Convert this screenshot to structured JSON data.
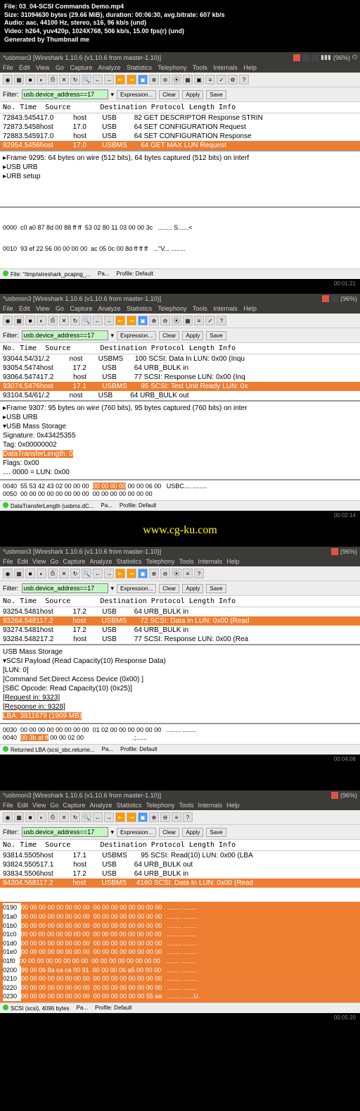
{
  "meta": {
    "file": "File: 03_04-SCSI Commands Demo.mp4",
    "size": "Size: 31094630 bytes (29.66 MiB), duration: 00:06:30, avg.bitrate: 607 kb/s",
    "audio": "Audio: aac, 44100 Hz, stereo, s16, 96 kb/s (und)",
    "video": "Video: h264, yuv420p, 1024X768, 506 kb/s, 15.00 fps(r) (und)",
    "gen": "Generated by Thumbnail me"
  },
  "menus": [
    "File",
    "Edit",
    "View",
    "Go",
    "Capture",
    "Analyze",
    "Statistics",
    "Telephony",
    "Tools",
    "Internals",
    "Help"
  ],
  "title_prefix": "*usbmon3   [Wireshark 1.10.6  (v1.10.6 from master-1.10)]",
  "tray": {
    "pct": "(96%)",
    "time_icon": "⏻"
  },
  "filter": {
    "label": "Filter:",
    "value": "usb.device_address==17",
    "exp": "Expression...",
    "clr": "Clear",
    "apl": "Apply",
    "sav": "Save"
  },
  "hdr": "No. Time  Source       Destination Protocol Length Info",
  "p1": {
    "rows": [
      {
        "t": "72843.545417.0          host        USB         82 GET DESCRIPTOR Response STRIN"
      },
      {
        "t": "72873.5458host          17.0        USB         64 SET CONFIGURATION Request"
      },
      {
        "t": "72883.545917.0          host        USB         64 SET CONFIGURATION Response"
      },
      {
        "t": "92954.5456host          17.0        USBMS       64 GET MAX LUN Request",
        "sel": true
      }
    ],
    "detail": [
      "▸Frame 9295: 64 bytes on wire (512 bits), 64 bytes captured (512 bits) on interf",
      "▸USB URB",
      "▸URB setup"
    ],
    "hex": [
      "0000  c0 a0 87 8d 00 88 ff ff  53 02 80 11 03 00 00 3c   ........ S......<",
      "0010  93 ef 22 56 00 00 00 00  ac 05 0c 00 8d ff ff ff   ...\"V... ........"
    ],
    "status": {
      "f": "File: \"/tmp/wireshark_pcapng_...",
      "p": "Pa...",
      "pr": "Profile: Default"
    },
    "ts": "00:01:21"
  },
  "p2": {
    "rows": [
      {
        "t": "93044.54/31/.2          nost        USBMS      100 SCSI: Data In LUN: 0x00 (Inqu"
      },
      {
        "t": "93054.5474host          17.2        USB         64 URB_BULK in"
      },
      {
        "t": "93064.547417.2          host        USB         77 SCSI: Response LUN: 0x00 (Inq"
      },
      {
        "t": "93074.5476host          17.1        USBMS       95 SCSI: Test Unit Ready LUN: 0x",
        "sel": true
      },
      {
        "t": "93104.54/61/.2          nost        USB         64 URB_BULK out"
      }
    ],
    "detail": [
      {
        "t": "▸Frame 9307: 95 bytes on wire (760 bits), 95 bytes captured (760 bits) on inter"
      },
      {
        "t": "▸USB URB"
      },
      {
        "t": "▾USB Mass Storage"
      },
      {
        "t": "   Signature: 0x43425355"
      },
      {
        "t": "   Tag: 0x00000002"
      },
      {
        "t": "   DataTransferLength: 0",
        "hl": true
      },
      {
        "t": "   Flags: 0x00"
      },
      {
        "t": "   .... 0000 = LUN: 0x00"
      }
    ],
    "hex": [
      "0040  55 53 42 43 02 00 00 00  ",
      "00 00 00 00",
      " 00 00 06 00   USBC.... ........",
      "0050  00 00 00 00 00 00 00 00  00 00 00 00 00 00 00"
    ],
    "status": {
      "f": "DataTransferLength (usbms.dC...",
      "p": "Pa...",
      "pr": "Profile: Default"
    },
    "ts": "00:02:14"
  },
  "wm": "www.cg-ku.com",
  "p3": {
    "rows": [
      {
        "t": "93254.5481host          17.2        USB         64 URB_BULK in"
      },
      {
        "t": "93264.548117.2          host        USBMS       72 SCSI: Data In LUN: 0x00 (Read",
        "sel": true
      },
      {
        "t": "93274.5481host          17.2        USB         64 URB_BULK in"
      },
      {
        "t": "93284.548217.2          host        USB         77 SCSI: Response LUN: 0x00 (Rea"
      }
    ],
    "detail": [
      {
        "t": " USB Mass Storage"
      },
      {
        "t": "▾SCSI Payload (Read Capacity(10) Response Data)"
      },
      {
        "t": "  [LUN: 0]"
      },
      {
        "t": "  [Command Set:Direct Access Device (0x00) ]"
      },
      {
        "t": "  [SBC Opcode: Read Capacity(10) (0x25)]"
      },
      {
        "t": "  [Request in: 9323]",
        "u": true
      },
      {
        "t": "  [Response in: 9328]",
        "u": true
      },
      {
        "t": "  LBA: 3911679 (1909 MB)",
        "hl": true
      }
    ],
    "hex": [
      "0030  00 00 00 00 00 00 00 00  01 02 00 00 00 00 00 00   ........ ........",
      "0040  ",
      "00 3b af ff",
      " 00 00 02 00                            .;......"
    ],
    "status": {
      "f": "Returned LBA (scsi_sbc.returne...",
      "p": "Pa...",
      "pr": "Profile: Default"
    },
    "ts": "00:04:08"
  },
  "p4": {
    "rows": [
      {
        "t": "93814.5505host          17.1        USBMS       95 SCSI: Read(10) LUN: 0x00 (LBA"
      },
      {
        "t": "93824.550517.1          host        USB         64 URB_BULK out"
      },
      {
        "t": "93834.5506host          17.2        USB         64 URB_BULK in"
      },
      {
        "t": "94204.568117.2          host        USBMS     4160 SCSI: Data In LUN: 0x00 (Read",
        "sel": true
      }
    ],
    "hexrows": [
      {
        "o": "0190",
        "h": "00 00 00 00 00 00 00 00  00 00 00 00 00 00 00 00",
        "a": "........ ........"
      },
      {
        "o": "01a0",
        "h": "00 00 00 00 00 00 00 00  00 00 00 00 00 00 00 00",
        "a": "........ ........"
      },
      {
        "o": "01b0",
        "h": "00 00 00 00 00 00 00 00  00 00 00 00 00 00 00 00",
        "a": "........ ........"
      },
      {
        "o": "01c0",
        "h": "00 00 00 00 00 00 00 00  00 00 00 00 00 00 00 00",
        "a": "........ ........"
      },
      {
        "o": "01d0",
        "h": "00 00 00 00 00 00 00 00  00 00 00 00 00 00 00 00",
        "a": "........ ........"
      },
      {
        "o": "01e0",
        "h": "00 00 00 00 00 00 00 00  00 00 00 00 00 00 00 00",
        "a": "........ ........"
      },
      {
        "o": "01f0",
        "h": "00 00 00 00 00 00 00 00  00 00 00 00 00 00 00 00",
        "a": "........ ........"
      },
      {
        "o": "0200",
        "h": "99 00 06 8a ca ca 00 91  00 00 00 06 a5 00 00 00",
        "a": "........ ........"
      },
      {
        "o": "0210",
        "h": "00 00 00 00 00 00 00 00  00 00 00 00 00 00 00 00",
        "a": "........ ........"
      },
      {
        "o": "0220",
        "h": "00 00 00 00 00 00 00 00  00 00 00 00 00 00 00 00",
        "a": "........ ........"
      },
      {
        "o": "0230",
        "h": "00 00 00 00 00 00 00 00  00 00 00 00 00 00 55 aa",
        "a": "........ ......U."
      }
    ],
    "status": {
      "f": "SCSI (scsi), 4096 bytes",
      "p": "Pa...",
      "pr": "Profile: Default"
    },
    "ts": "00:05:20"
  }
}
